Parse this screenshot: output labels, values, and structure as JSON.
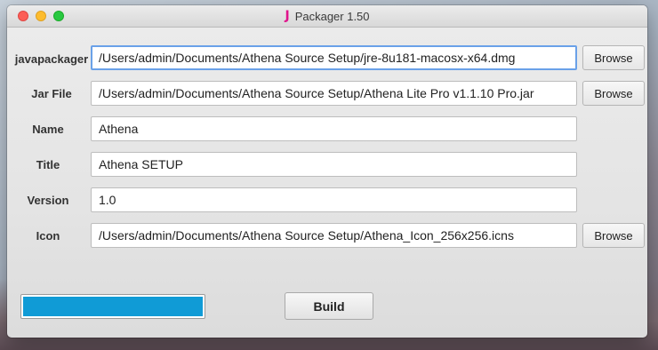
{
  "window": {
    "title": "Packager 1.50",
    "app_icon": "J"
  },
  "form": {
    "rows": [
      {
        "label": "javapackager",
        "value": "/Users/admin/Documents/Athena Source Setup/jre-8u181-macosx-x64.dmg",
        "browse": "Browse"
      },
      {
        "label": "Jar File",
        "value": "/Users/admin/Documents/Athena Source Setup/Athena Lite Pro v1.1.10 Pro.jar",
        "browse": "Browse"
      },
      {
        "label": "Name",
        "value": "Athena"
      },
      {
        "label": "Title",
        "value": "Athena SETUP"
      },
      {
        "label": "Version",
        "value": "1.0"
      },
      {
        "label": "Icon",
        "value": "/Users/admin/Documents/Athena Source Setup/Athena_Icon_256x256.icns",
        "browse": "Browse"
      }
    ]
  },
  "footer": {
    "progress": 1.0,
    "progress_color": "#109bd6",
    "build_label": "Build"
  },
  "colors": {
    "focus_ring": "#6aa1e8",
    "close": "#fc5f57",
    "minimize": "#fdbc2e",
    "maximize": "#28c840",
    "icon": "#e0148c"
  }
}
